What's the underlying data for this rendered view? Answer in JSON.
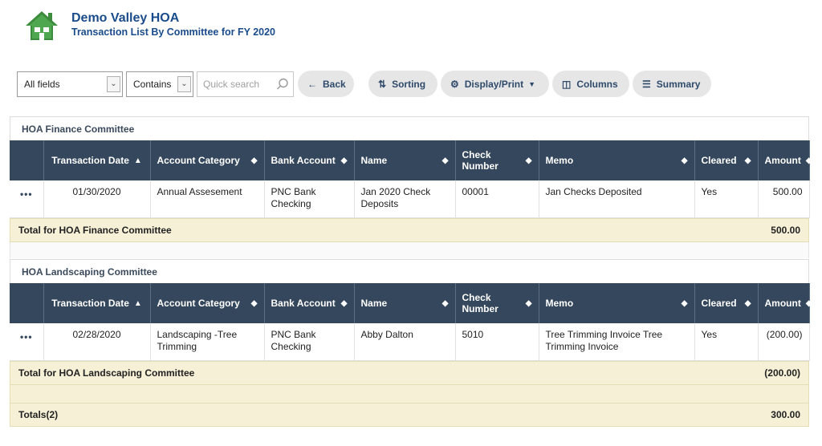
{
  "header": {
    "title": "Demo Valley HOA",
    "subtitle": "Transaction List By Committee for FY 2020",
    "logo_icon": "house-icon",
    "brand_color": "#1a4c8b"
  },
  "toolbar": {
    "field_select_value": "All fields",
    "operator_select_value": "Contains",
    "search_placeholder": "Quick search",
    "back_label": "Back",
    "sorting_label": "Sorting",
    "display_label": "Display/Print",
    "columns_label": "Columns",
    "summary_label": "Summary"
  },
  "columns": [
    {
      "label": "Transaction Date"
    },
    {
      "label": "Account Category"
    },
    {
      "label": "Bank Account"
    },
    {
      "label": "Name"
    },
    {
      "label": "Check Number"
    },
    {
      "label": "Memo"
    },
    {
      "label": "Cleared"
    },
    {
      "label": "Amount"
    }
  ],
  "groups": [
    {
      "title": "HOA Finance Committee",
      "rows": [
        {
          "date": "01/30/2020",
          "category": "Annual Assesement",
          "bank": "PNC Bank Checking",
          "name": "Jan 2020 Check Deposits",
          "check": "00001",
          "memo": "Jan Checks Deposited",
          "cleared": "Yes",
          "amount": "500.00"
        }
      ],
      "total_label": "Total for HOA Finance Committee",
      "total_amount": "500.00"
    },
    {
      "title": "HOA Landscaping Committee",
      "rows": [
        {
          "date": "02/28/2020",
          "category": "Landscaping -Tree Trimming",
          "bank": "PNC Bank Checking",
          "name": "Abby Dalton",
          "check": "5010",
          "memo": "Tree Trimming Invoice Tree Trimming Invoice",
          "cleared": "Yes",
          "amount": "(200.00)"
        }
      ],
      "total_label": "Total for HOA Landscaping Committee",
      "total_amount": "(200.00)"
    }
  ],
  "grand_total": {
    "label": "Totals(2)",
    "amount": "300.00"
  }
}
